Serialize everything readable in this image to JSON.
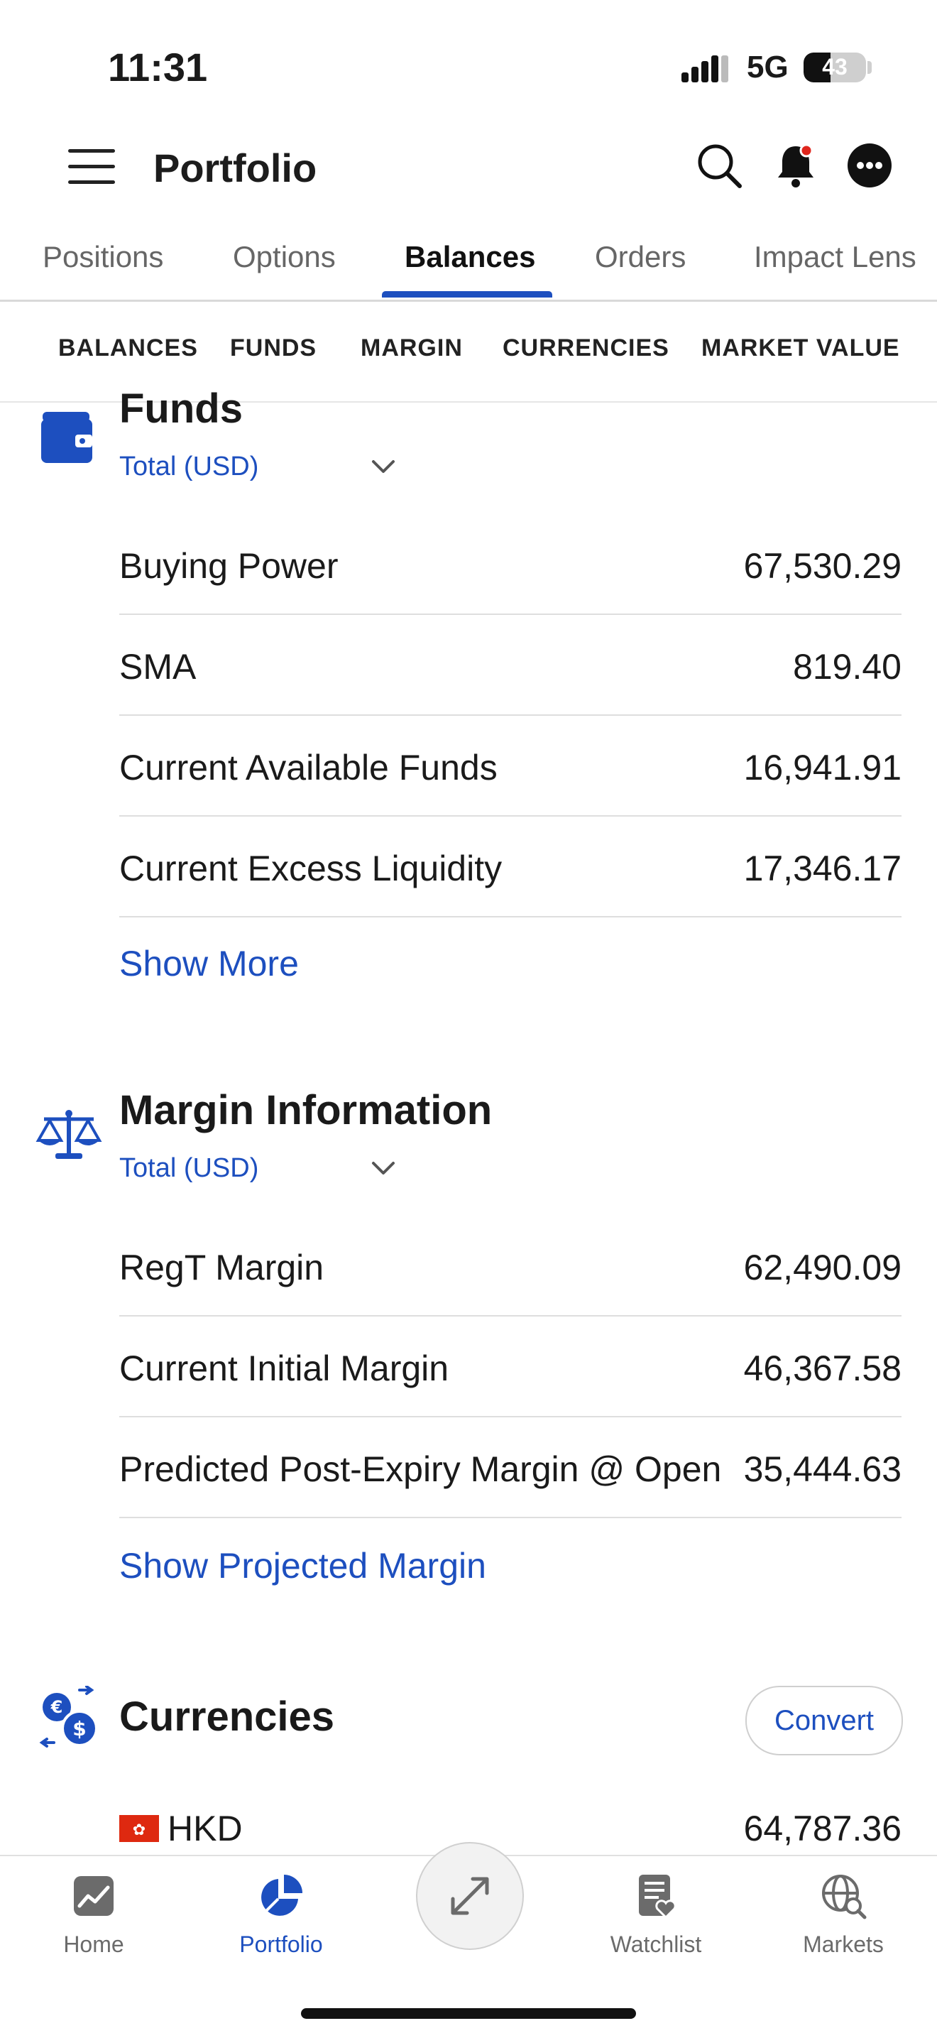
{
  "status_bar": {
    "time": "11:31",
    "network": "5G",
    "battery": "43",
    "battery_level": 0.43
  },
  "header": {
    "title": "Portfolio"
  },
  "tabs": [
    {
      "label": "Positions"
    },
    {
      "label": "Options"
    },
    {
      "label": "Balances",
      "active": true
    },
    {
      "label": "Orders"
    },
    {
      "label": "Impact Lens"
    }
  ],
  "subtabs": [
    {
      "label": "BALANCES"
    },
    {
      "label": "FUNDS"
    },
    {
      "label": "MARGIN"
    },
    {
      "label": "CURRENCIES"
    },
    {
      "label": "MARKET VALUE"
    }
  ],
  "funds": {
    "title": "Funds",
    "selector": "Total (USD)",
    "rows": [
      {
        "label": "Buying Power",
        "value": "67,530.29"
      },
      {
        "label": "SMA",
        "value": "819.40"
      },
      {
        "label": "Current Available Funds",
        "value": "16,941.91"
      },
      {
        "label": "Current Excess Liquidity",
        "value": "17,346.17"
      }
    ],
    "show_more": "Show More"
  },
  "margin": {
    "title": "Margin Information",
    "selector": "Total (USD)",
    "rows": [
      {
        "label": "RegT Margin",
        "value": "62,490.09"
      },
      {
        "label": "Current Initial Margin",
        "value": "46,367.58"
      },
      {
        "label": "Predicted Post-Expiry Margin @ Open",
        "value": "35,444.63"
      }
    ],
    "show_projected": "Show Projected Margin"
  },
  "currencies": {
    "title": "Currencies",
    "convert_label": "Convert",
    "items": [
      {
        "code": "HKD",
        "value": "64,787.36"
      }
    ]
  },
  "bottom_nav": [
    {
      "label": "Home",
      "icon": "home-chart-icon"
    },
    {
      "label": "Portfolio",
      "icon": "pie-chart-icon",
      "active": true
    },
    {
      "label": "Watchlist",
      "icon": "watchlist-icon"
    },
    {
      "label": "Markets",
      "icon": "globe-search-icon"
    }
  ],
  "colors": {
    "accent": "#1d4fbf",
    "text": "#1a1a1a",
    "muted": "#6b6b6b",
    "divider": "#dedede"
  }
}
